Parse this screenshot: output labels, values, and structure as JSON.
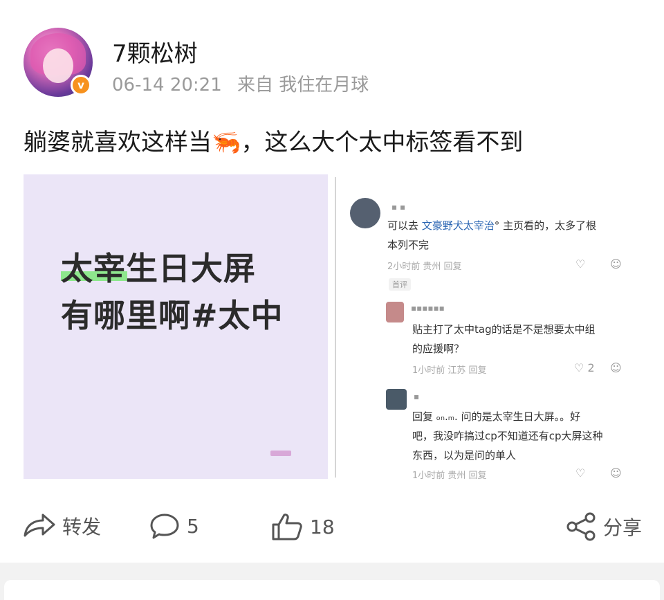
{
  "post": {
    "username": "7颗松树",
    "time": "06-14 20:21",
    "source": "来自 我住在月球",
    "text": "躺婆就喜欢这样当🦐，这么大个太中标签看不到",
    "verified_glyph": "v"
  },
  "image_left": {
    "line1": "太宰生日大屏",
    "line2": "有哪里啊#太中"
  },
  "image_right": {
    "c1": {
      "name": "▪ ▪",
      "text_prefix": "可以去 ",
      "link": "文豪野犬太宰治",
      "text_suffix": "° 主页看的，太多了根",
      "text_line2": "本列不完",
      "meta": "2小时前 贵州  回复",
      "tag": "首评"
    },
    "c2": {
      "name": "▪▪▪▪▪▪",
      "text_line1": "贴主打了太中tag的话是不是想要太中组",
      "text_line2": "的应援啊？",
      "meta": "1小时前 江苏  回复",
      "likes": "2"
    },
    "c3": {
      "name": "▪",
      "text_line1": "回复 ₒₙ.ₘ. 问的是太宰生日大屏。。好",
      "text_line2": "吧，我没咋搞过cp不知道还有cp大屏这种",
      "text_line3": "东西，以为是问的单人",
      "meta": "1小时前 贵州  回复"
    },
    "like_icon": "♡",
    "emoji_icon": "☺"
  },
  "actions": {
    "repost": "转发",
    "comments": "5",
    "likes": "18",
    "share": "分享"
  }
}
